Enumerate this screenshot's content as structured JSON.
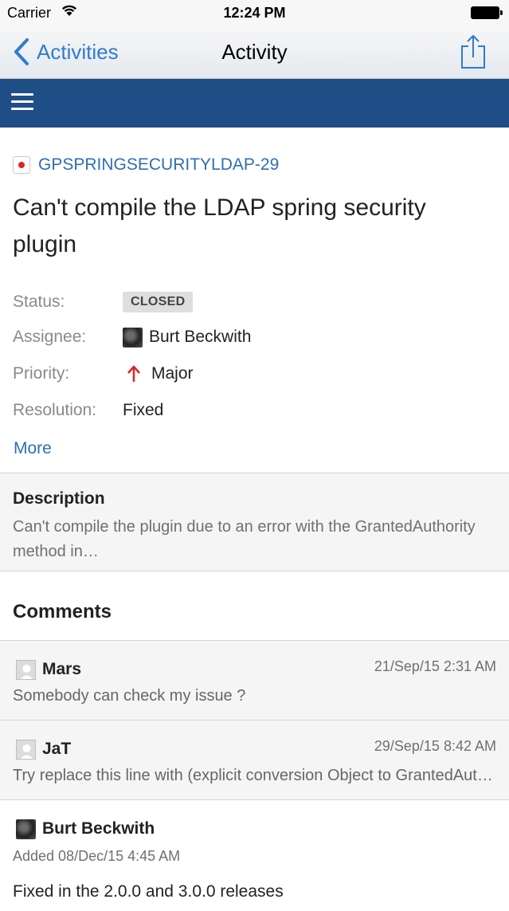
{
  "status_bar": {
    "carrier": "Carrier",
    "time": "12:24 PM"
  },
  "nav": {
    "back_label": "Activities",
    "title": "Activity",
    "back_icon": "chevron-left-icon",
    "share_icon": "share-icon"
  },
  "toolbar": {
    "menu_icon": "hamburger-menu-icon",
    "background": "#1f4e86"
  },
  "issue": {
    "key": "GPSPRINGSECURITYLDAP-29",
    "type_icon": "bug-icon",
    "summary": "Can't compile the LDAP spring security plugin",
    "fields": [
      {
        "label": "Status:",
        "value": "CLOSED"
      },
      {
        "label": "Assignee:",
        "value": "Burt Beckwith"
      },
      {
        "label": "Priority:",
        "value": "Major"
      },
      {
        "label": "Resolution:",
        "value": "Fixed"
      }
    ],
    "more_label": "More"
  },
  "description": {
    "title": "Description",
    "text": "Can't compile the plugin due to an error with the GrantedAuthority method in…"
  },
  "comments": {
    "heading": "Comments",
    "items": [
      {
        "author": "Mars",
        "date": "21/Sep/15 2:31 AM",
        "text": "Somebody can check my issue ?"
      },
      {
        "author": "JaT",
        "date": "29/Sep/15 8:42 AM",
        "text": "Try replace this line with (explicit conversion Object to GrantedAuthority)"
      },
      {
        "author": "Burt Beckwith",
        "added": "Added 08/Dec/15 4:45 AM",
        "text": "Fixed in the 2.0.0 and 3.0.0 releases"
      }
    ]
  },
  "colors": {
    "link": "#2f6fb2",
    "ios_blue": "#2f7bd1",
    "priority_major": "#d9262b"
  }
}
